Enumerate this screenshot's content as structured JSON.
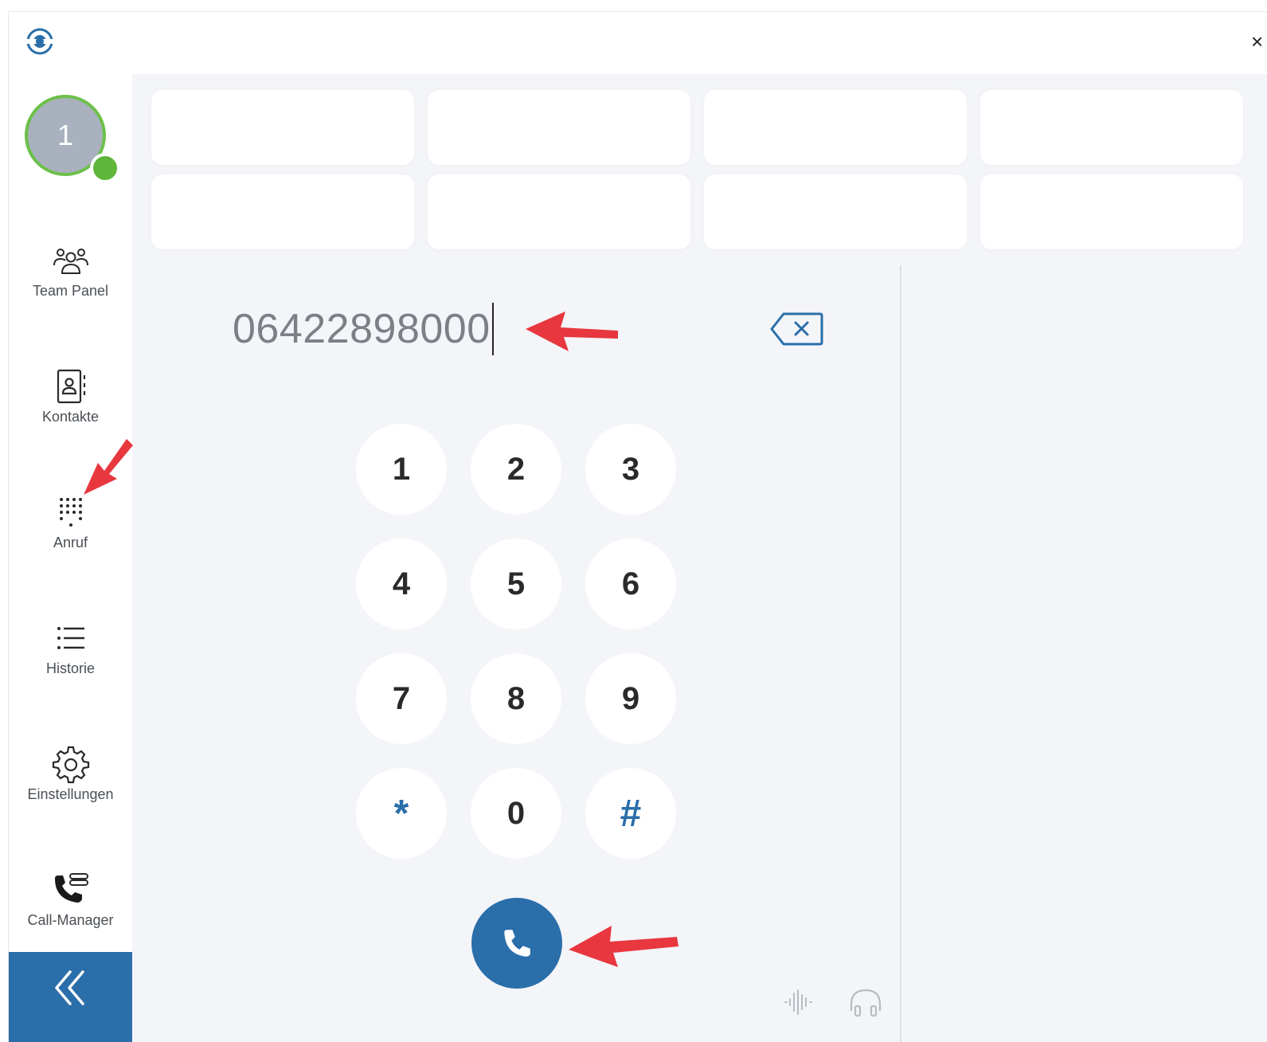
{
  "window": {
    "close_glyph": "×"
  },
  "profile": {
    "avatar_text": "1",
    "status_color": "#5fb63a"
  },
  "sidebar": {
    "items": [
      {
        "id": "team-panel",
        "label": "Team Panel",
        "icon": "team-icon"
      },
      {
        "id": "kontakte",
        "label": "Kontakte",
        "icon": "contacts-icon"
      },
      {
        "id": "anruf",
        "label": "Anruf",
        "icon": "dialpad-icon"
      },
      {
        "id": "historie",
        "label": "Historie",
        "icon": "list-icon"
      },
      {
        "id": "einstellungen",
        "label": "Einstellungen",
        "icon": "gear-icon"
      },
      {
        "id": "call-manager",
        "label": "Call-Manager",
        "icon": "call-manager-icon"
      }
    ],
    "collapse_glyph": "«"
  },
  "dialer": {
    "number": "06422898000",
    "keys": [
      "1",
      "2",
      "3",
      "4",
      "5",
      "6",
      "7",
      "8",
      "9",
      "*",
      "0",
      "#"
    ]
  },
  "colors": {
    "accent": "#2a6eaa",
    "annotation": "#e8373e",
    "presence": "#5fb63a"
  }
}
